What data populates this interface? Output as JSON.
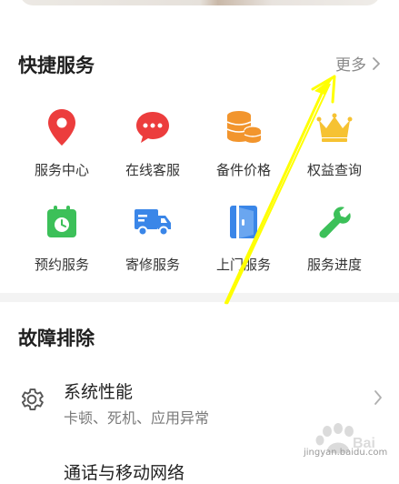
{
  "quick_services": {
    "title": "快捷服务",
    "more_label": "更多",
    "items": [
      {
        "label": "服务中心",
        "icon": "location-pin-icon"
      },
      {
        "label": "在线客服",
        "icon": "chat-bubble-icon"
      },
      {
        "label": "备件价格",
        "icon": "coin-stack-icon"
      },
      {
        "label": "权益查询",
        "icon": "crown-icon"
      },
      {
        "label": "预约服务",
        "icon": "calendar-clock-icon"
      },
      {
        "label": "寄修服务",
        "icon": "delivery-truck-icon"
      },
      {
        "label": "上门服务",
        "icon": "door-icon"
      },
      {
        "label": "服务进度",
        "icon": "wrench-icon"
      }
    ]
  },
  "troubleshooting": {
    "title": "故障排除",
    "items": [
      {
        "title": "系统性能",
        "subtitle": "卡顿、死机、应用异常",
        "icon": "gear-icon"
      },
      {
        "title": "通话与移动网络"
      }
    ]
  },
  "watermark": {
    "text": "jingyan.baidu.com"
  },
  "colors": {
    "red": "#ec3d3d",
    "orange": "#f2952d",
    "gold": "#f6c232",
    "green": "#3cc059",
    "blue": "#3a86e8",
    "annotation_arrow": "#ffff00"
  }
}
